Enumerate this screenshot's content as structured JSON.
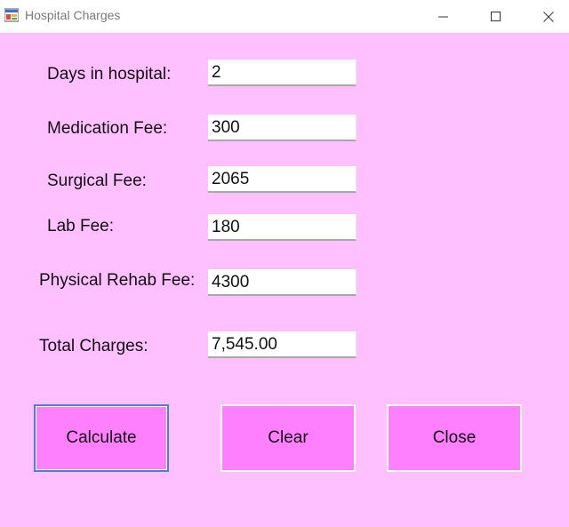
{
  "window": {
    "title": "Hospital Charges"
  },
  "form": {
    "days_label": "Days in hospital:",
    "days_value": "2",
    "medication_label": "Medication Fee:",
    "medication_value": "300",
    "surgical_label": "Surgical Fee:",
    "surgical_value": "2065",
    "lab_label": "Lab Fee:",
    "lab_value": "180",
    "rehab_label": "Physical Rehab Fee:",
    "rehab_value": "4300",
    "total_label": "Total Charges:",
    "total_value": "7,545.00"
  },
  "buttons": {
    "calculate": "Calculate",
    "clear": "Clear",
    "close": "Close"
  },
  "colors": {
    "background": "#ffc0ff",
    "button": "#ff80ff",
    "focus_border": "#4a7fd6"
  },
  "icons": {
    "app": "winforms-app-icon",
    "minimize": "minimize-icon",
    "maximize": "maximize-icon",
    "close": "close-icon"
  }
}
